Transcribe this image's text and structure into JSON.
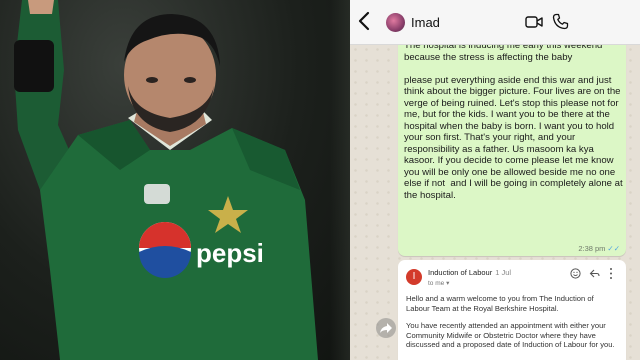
{
  "chat": {
    "contact_name": "Imad",
    "message": {
      "text": "The hospital is inducing me early this weekend because the stress is affecting the baby\n\nplease put everything aside end this war and just think about the bigger picture. Four lives are on the verge of being ruined. Let's stop this please not for me, but for the kids. I want you to be there at the hospital when the baby is born. I want you to hold your son first. That's your right, and your responsibility as a father. Us masoom ka kya kasoor. If you decide to come please let me know you will be only one be allowed beside me no one else if not  and I will be going in completely alone at the hospital.",
      "time": "2:38 pm",
      "ticks": "✓✓"
    },
    "email": {
      "sender_initial": "I",
      "subject": "Induction of Labour",
      "date": "1 Jul",
      "to": "to me",
      "body_1": "Hello and a warm welcome to you from The Induction of Labour Team at the Royal Berkshire Hospital.",
      "body_2": "You have recently attended an appointment with either your Community Midwife or Obstetric Doctor where they have discussed and a proposed date of Induction of Labour for you."
    }
  },
  "colors": {
    "bubble": "#dcf7c6",
    "chat_bg": "#e6e0d6",
    "jersey": "#1f6b3a",
    "read_ticks": "#4fa3e0"
  },
  "icons": [
    "back-chevron-icon",
    "video-call-icon",
    "phone-icon",
    "smile-icon",
    "reply-icon",
    "more-vertical-icon",
    "forward-icon"
  ]
}
